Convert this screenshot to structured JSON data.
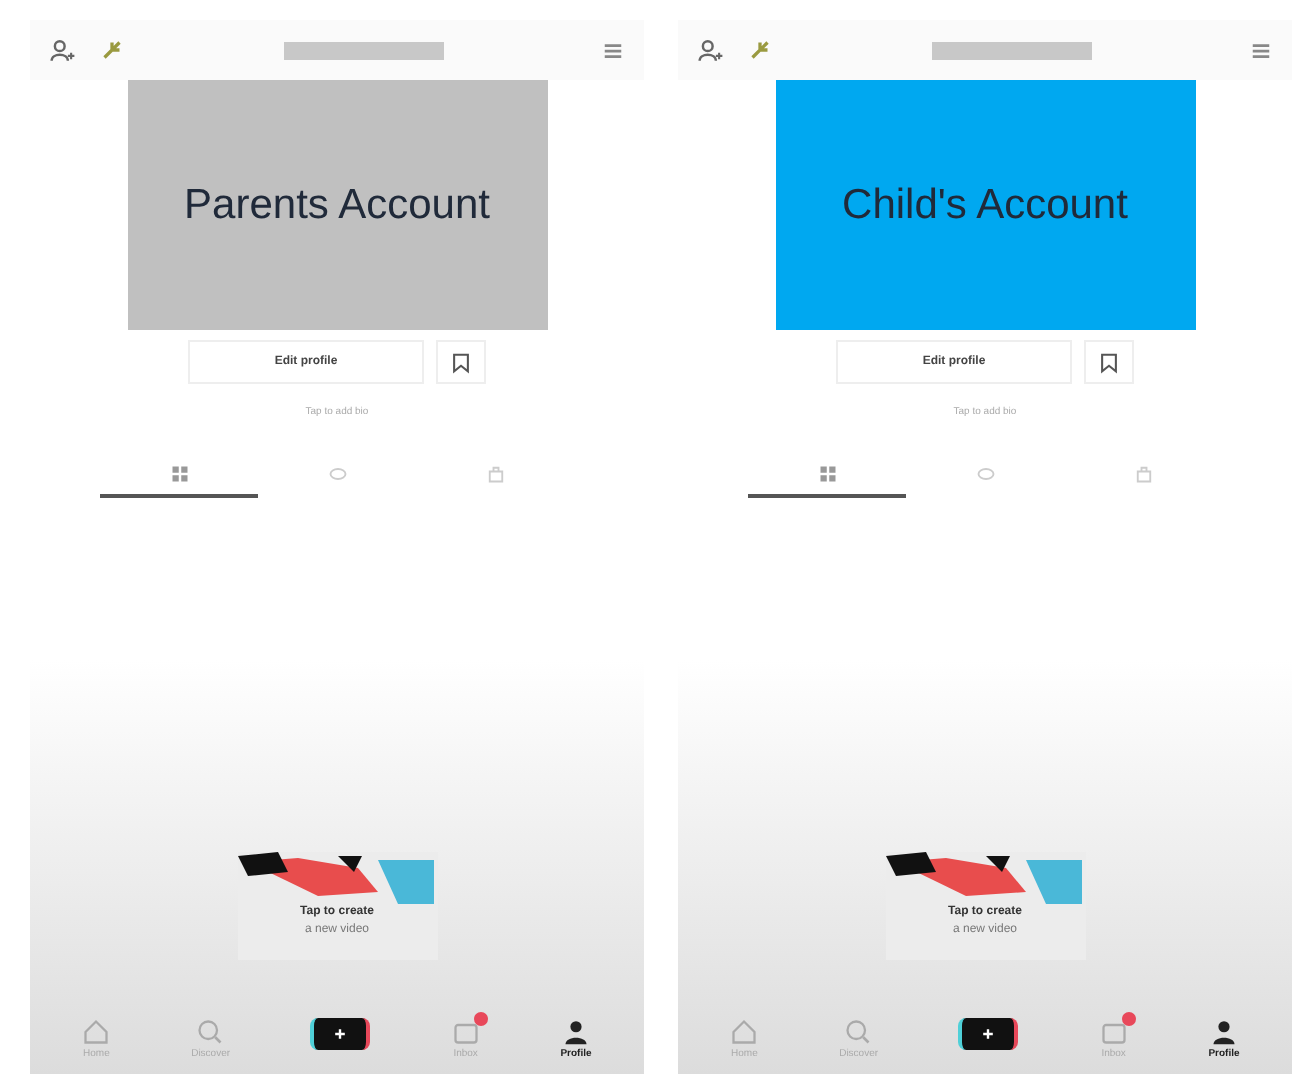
{
  "panels": [
    {
      "banner": {
        "text": "Parents Account",
        "color": "#c0c0c0"
      },
      "edit_button": "Edit profile",
      "bio_hint": "Tap to add bio",
      "tabs": [
        {
          "selected": true
        },
        {
          "selected": false
        },
        {
          "selected": false
        }
      ],
      "create_card": {
        "line_1": "Tap to create",
        "line_2": "a new video"
      },
      "nav": [
        {
          "kind": "home",
          "label": "Home",
          "selected": false
        },
        {
          "kind": "discover",
          "label": "Discover",
          "selected": false
        },
        {
          "kind": "create"
        },
        {
          "kind": "inbox",
          "label": "Inbox",
          "selected": false,
          "badge": true
        },
        {
          "kind": "profile",
          "label": "Profile",
          "selected": true
        }
      ]
    },
    {
      "banner": {
        "text": "Child's Account",
        "color": "#00a8f0"
      },
      "edit_button": "Edit profile",
      "bio_hint": "Tap to add bio",
      "tabs": [
        {
          "selected": true
        },
        {
          "selected": false
        },
        {
          "selected": false
        }
      ],
      "create_card": {
        "line_1": "Tap to create",
        "line_2": "a new video"
      },
      "nav": [
        {
          "kind": "home",
          "label": "Home",
          "selected": false
        },
        {
          "kind": "discover",
          "label": "Discover",
          "selected": false
        },
        {
          "kind": "create"
        },
        {
          "kind": "inbox",
          "label": "Inbox",
          "selected": false,
          "badge": true
        },
        {
          "kind": "profile",
          "label": "Profile",
          "selected": true
        }
      ]
    }
  ]
}
